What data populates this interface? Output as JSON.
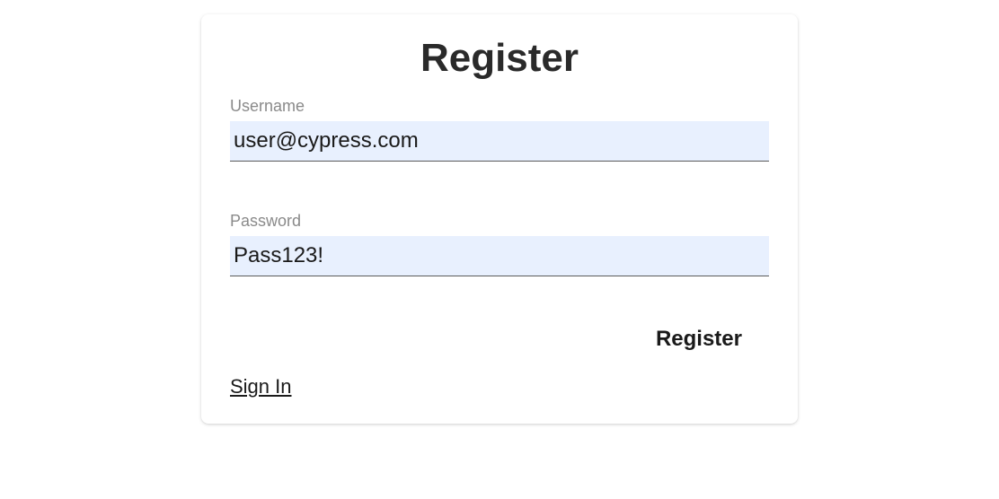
{
  "form": {
    "title": "Register",
    "username": {
      "label": "Username",
      "value": "user@cypress.com"
    },
    "password": {
      "label": "Password",
      "value": "Pass123!"
    },
    "submit_label": "Register",
    "signin_label": "Sign In"
  }
}
